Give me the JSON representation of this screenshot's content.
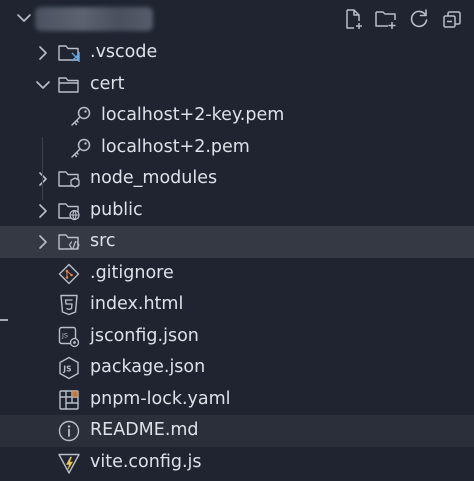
{
  "explorer": {
    "title": "my-app-vite",
    "actions": [
      {
        "name": "new-file-icon",
        "label": "New File"
      },
      {
        "name": "new-folder-icon",
        "label": "New Folder"
      },
      {
        "name": "refresh-icon",
        "label": "Refresh"
      },
      {
        "name": "collapse-all-icon",
        "label": "Collapse"
      }
    ]
  },
  "tree": {
    "items": [
      {
        "label": ".vscode",
        "kind": "folder",
        "expanded": false,
        "icon": "folder-vscode-icon"
      },
      {
        "label": "cert",
        "kind": "folder",
        "expanded": true,
        "icon": "folder-icon"
      },
      {
        "label": "localhost+2-key.pem",
        "kind": "file",
        "icon": "key-icon"
      },
      {
        "label": "localhost+2.pem",
        "kind": "file",
        "icon": "key-icon"
      },
      {
        "label": "node_modules",
        "kind": "folder",
        "expanded": false,
        "icon": "folder-node-icon"
      },
      {
        "label": "public",
        "kind": "folder",
        "expanded": false,
        "icon": "folder-public-icon"
      },
      {
        "label": "src",
        "kind": "folder",
        "expanded": false,
        "icon": "folder-src-icon",
        "selected": true
      },
      {
        "label": ".gitignore",
        "kind": "file",
        "icon": "git-icon"
      },
      {
        "label": "index.html",
        "kind": "file",
        "icon": "html-icon"
      },
      {
        "label": "jsconfig.json",
        "kind": "file",
        "icon": "jsconfig-icon"
      },
      {
        "label": "package.json",
        "kind": "file",
        "icon": "nodejs-icon"
      },
      {
        "label": "pnpm-lock.yaml",
        "kind": "file",
        "icon": "pnpm-icon"
      },
      {
        "label": "README.md",
        "kind": "file",
        "icon": "info-icon",
        "hovered": true
      },
      {
        "label": "vite.config.js",
        "kind": "file",
        "icon": "vite-icon"
      }
    ]
  },
  "colors": {
    "background": "#1f2430",
    "selected": "#343944",
    "hovered": "#2a2f39",
    "text": "#dde1e8",
    "icon": "#b9bec8"
  }
}
